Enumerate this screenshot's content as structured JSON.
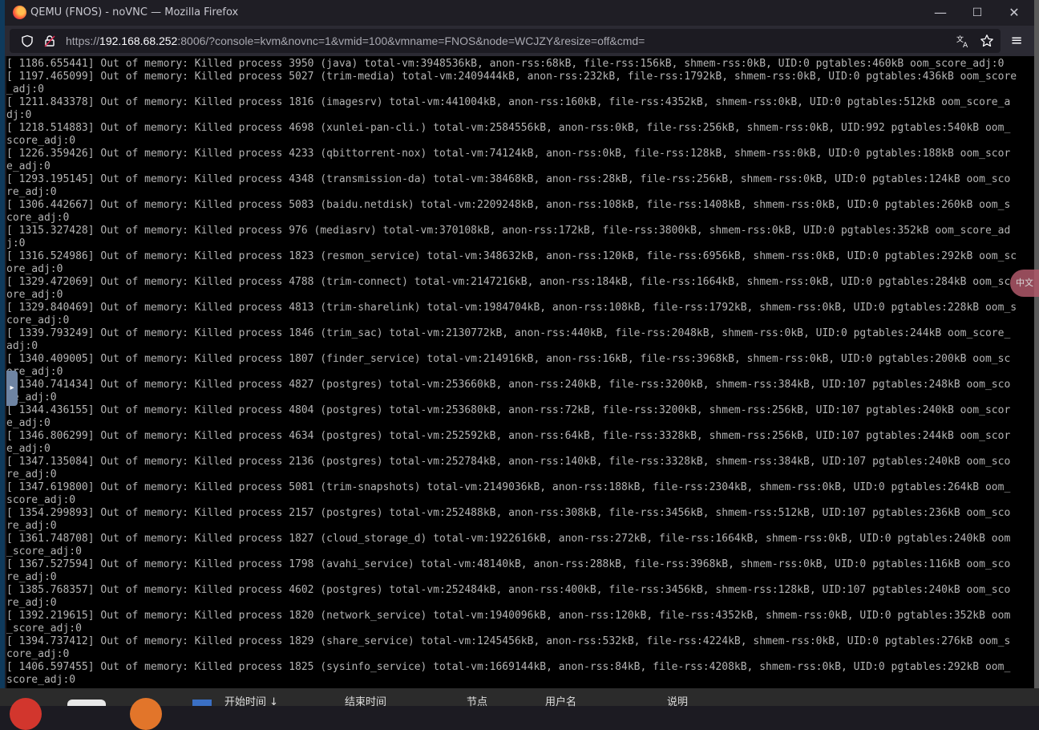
{
  "window": {
    "title": "QEMU (FNOS) - noVNC — Mozilla Firefox",
    "minimize_glyph": "—",
    "maximize_glyph": "☐",
    "close_glyph": "✕"
  },
  "navbar": {
    "url_prefix": "https://",
    "url_host": "192.168.68.252",
    "url_rest": ":8006/?console=kvm&novnc=1&vmid=100&vmname=FNOS&node=WCJZY&resize=off&cmd=",
    "icons": [
      "shield-icon",
      "lock-icon",
      "translate-icon",
      "bookmark-star-icon",
      "hamburger-menu-icon"
    ]
  },
  "console": {
    "lines": [
      "[ 1186.655441] Out of memory: Killed process 3950 (java) total-vm:3948536kB, anon-rss:68kB, file-rss:156kB, shmem-rss:0kB, UID:0 pgtables:460kB oom_score_adj:0",
      "[ 1197.465099] Out of memory: Killed process 5027 (trim-media) total-vm:2409444kB, anon-rss:232kB, file-rss:1792kB, shmem-rss:0kB, UID:0 pgtables:436kB oom_score",
      "_adj:0",
      "[ 1211.843378] Out of memory: Killed process 1816 (imagesrv) total-vm:441004kB, anon-rss:160kB, file-rss:4352kB, shmem-rss:0kB, UID:0 pgtables:512kB oom_score_a",
      "dj:0",
      "[ 1218.514883] Out of memory: Killed process 4698 (xunlei-pan-cli.) total-vm:2584556kB, anon-rss:0kB, file-rss:256kB, shmem-rss:0kB, UID:992 pgtables:540kB oom_",
      "score_adj:0",
      "[ 1226.359426] Out of memory: Killed process 4233 (qbittorrent-nox) total-vm:74124kB, anon-rss:0kB, file-rss:128kB, shmem-rss:0kB, UID:0 pgtables:188kB oom_scor",
      "e_adj:0",
      "[ 1293.195145] Out of memory: Killed process 4348 (transmission-da) total-vm:38468kB, anon-rss:28kB, file-rss:256kB, shmem-rss:0kB, UID:0 pgtables:124kB oom_sco",
      "re_adj:0",
      "[ 1306.442667] Out of memory: Killed process 5083 (baidu.netdisk) total-vm:2209248kB, anon-rss:108kB, file-rss:1408kB, shmem-rss:0kB, UID:0 pgtables:260kB oom_s",
      "core_adj:0",
      "[ 1315.327428] Out of memory: Killed process 976 (mediasrv) total-vm:370108kB, anon-rss:172kB, file-rss:3800kB, shmem-rss:0kB, UID:0 pgtables:352kB oom_score_ad",
      "j:0",
      "[ 1316.524986] Out of memory: Killed process 1823 (resmon_service) total-vm:348632kB, anon-rss:120kB, file-rss:6956kB, shmem-rss:0kB, UID:0 pgtables:292kB oom_sc",
      "ore_adj:0",
      "[ 1329.472069] Out of memory: Killed process 4788 (trim-connect) total-vm:2147216kB, anon-rss:184kB, file-rss:1664kB, shmem-rss:0kB, UID:0 pgtables:284kB oom_sc",
      "ore_adj:0",
      "[ 1329.840469] Out of memory: Killed process 4813 (trim-sharelink) total-vm:1984704kB, anon-rss:108kB, file-rss:1792kB, shmem-rss:0kB, UID:0 pgtables:228kB oom_s",
      "core_adj:0",
      "[ 1339.793249] Out of memory: Killed process 1846 (trim_sac) total-vm:2130772kB, anon-rss:440kB, file-rss:2048kB, shmem-rss:0kB, UID:0 pgtables:244kB oom_score_",
      "adj:0",
      "[ 1340.409005] Out of memory: Killed process 1807 (finder_service) total-vm:214916kB, anon-rss:16kB, file-rss:3968kB, shmem-rss:0kB, UID:0 pgtables:200kB oom_sc",
      "ore_adj:0",
      "[ 1340.741434] Out of memory: Killed process 4827 (postgres) total-vm:253660kB, anon-rss:240kB, file-rss:3200kB, shmem-rss:384kB, UID:107 pgtables:248kB oom_sco",
      "re_adj:0",
      "[ 1344.436155] Out of memory: Killed process 4804 (postgres) total-vm:253680kB, anon-rss:72kB, file-rss:3200kB, shmem-rss:256kB, UID:107 pgtables:240kB oom_scor",
      "e_adj:0",
      "[ 1346.806299] Out of memory: Killed process 4634 (postgres) total-vm:252592kB, anon-rss:64kB, file-rss:3328kB, shmem-rss:256kB, UID:107 pgtables:244kB oom_scor",
      "e_adj:0",
      "[ 1347.135084] Out of memory: Killed process 2136 (postgres) total-vm:252784kB, anon-rss:140kB, file-rss:3328kB, shmem-rss:384kB, UID:107 pgtables:240kB oom_sco",
      "re_adj:0",
      "[ 1347.619800] Out of memory: Killed process 5081 (trim-snapshots) total-vm:2149036kB, anon-rss:188kB, file-rss:2304kB, shmem-rss:0kB, UID:0 pgtables:264kB oom_",
      "score_adj:0",
      "[ 1354.299893] Out of memory: Killed process 2157 (postgres) total-vm:252488kB, anon-rss:308kB, file-rss:3456kB, shmem-rss:512kB, UID:107 pgtables:236kB oom_sco",
      "re_adj:0",
      "[ 1361.748708] Out of memory: Killed process 1827 (cloud_storage_d) total-vm:1922616kB, anon-rss:272kB, file-rss:1664kB, shmem-rss:0kB, UID:0 pgtables:240kB oom",
      "_score_adj:0",
      "[ 1367.527594] Out of memory: Killed process 1798 (avahi_service) total-vm:48140kB, anon-rss:288kB, file-rss:3968kB, shmem-rss:0kB, UID:0 pgtables:116kB oom_sco",
      "re_adj:0",
      "[ 1385.768357] Out of memory: Killed process 4602 (postgres) total-vm:252484kB, anon-rss:400kB, file-rss:3456kB, shmem-rss:128kB, UID:107 pgtables:240kB oom_sco",
      "re_adj:0",
      "[ 1392.219615] Out of memory: Killed process 1820 (network_service) total-vm:1940096kB, anon-rss:120kB, file-rss:4352kB, shmem-rss:0kB, UID:0 pgtables:352kB oom",
      "_score_adj:0",
      "[ 1394.737412] Out of memory: Killed process 1829 (share_service) total-vm:1245456kB, anon-rss:532kB, file-rss:4224kB, shmem-rss:0kB, UID:0 pgtables:276kB oom_s",
      "core_adj:0",
      "[ 1406.597455] Out of memory: Killed process 1825 (sysinfo_service) total-vm:1669144kB, anon-rss:84kB, file-rss:4208kB, shmem-rss:0kB, UID:0 pgtables:292kB oom_",
      "score_adj:0"
    ]
  },
  "novnc": {
    "sidebar_handle_glyph": "▸",
    "ime_badge": "中文"
  },
  "taskbar": {
    "columns": [
      "开始时间 ↓",
      "结束时间",
      "节点",
      "用户名",
      "说明"
    ]
  },
  "colors": {
    "console_bg": "#000000",
    "console_text": "#b4b4b4",
    "firefox_chrome": "#2b2a33",
    "titlebar": "#1f1e25"
  }
}
